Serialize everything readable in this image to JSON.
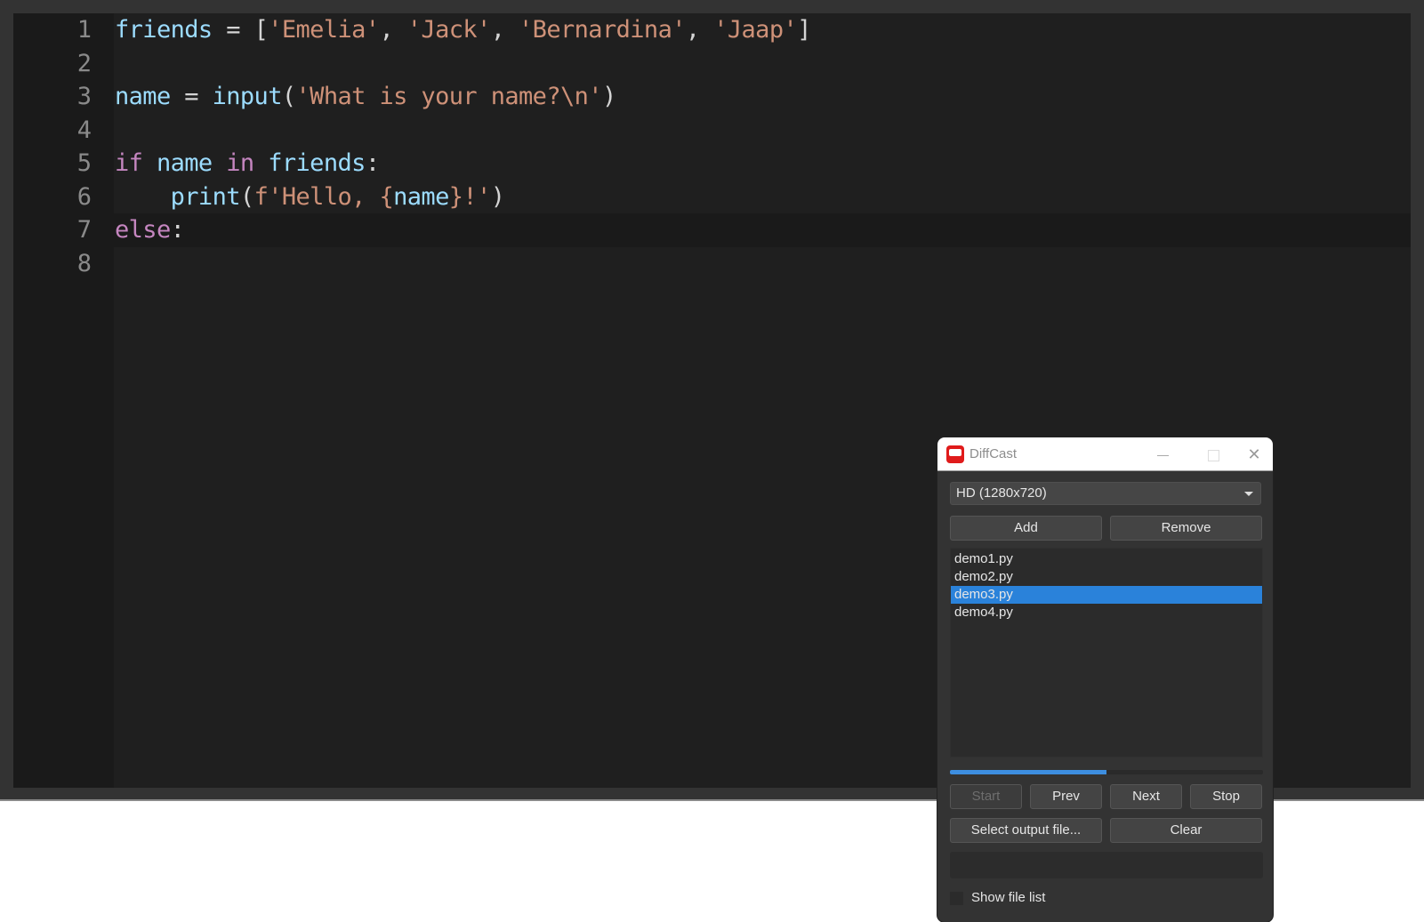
{
  "editor": {
    "current_line": 7,
    "lines": [
      {
        "number": "1",
        "tokens": [
          {
            "t": "friends",
            "c": "var"
          },
          {
            "t": " = ",
            "c": "op"
          },
          {
            "t": "[",
            "c": "op"
          },
          {
            "t": "'Emelia'",
            "c": "str"
          },
          {
            "t": ", ",
            "c": "op"
          },
          {
            "t": "'Jack'",
            "c": "str"
          },
          {
            "t": ", ",
            "c": "op"
          },
          {
            "t": "'Bernardina'",
            "c": "str"
          },
          {
            "t": ", ",
            "c": "op"
          },
          {
            "t": "'Jaap'",
            "c": "str"
          },
          {
            "t": "]",
            "c": "op"
          }
        ]
      },
      {
        "number": "2",
        "tokens": []
      },
      {
        "number": "3",
        "tokens": [
          {
            "t": "name",
            "c": "var"
          },
          {
            "t": " = ",
            "c": "op"
          },
          {
            "t": "input",
            "c": "fn"
          },
          {
            "t": "(",
            "c": "op"
          },
          {
            "t": "'What is your name?\\n'",
            "c": "str"
          },
          {
            "t": ")",
            "c": "op"
          }
        ]
      },
      {
        "number": "4",
        "tokens": []
      },
      {
        "number": "5",
        "tokens": [
          {
            "t": "if",
            "c": "kw"
          },
          {
            "t": " ",
            "c": "op"
          },
          {
            "t": "name",
            "c": "var"
          },
          {
            "t": " ",
            "c": "op"
          },
          {
            "t": "in",
            "c": "kw"
          },
          {
            "t": " ",
            "c": "op"
          },
          {
            "t": "friends",
            "c": "var"
          },
          {
            "t": ":",
            "c": "op"
          }
        ]
      },
      {
        "number": "6",
        "tokens": [
          {
            "t": "    ",
            "c": "op"
          },
          {
            "t": "print",
            "c": "fn"
          },
          {
            "t": "(",
            "c": "op"
          },
          {
            "t": "f'Hello, ",
            "c": "str"
          },
          {
            "t": "{",
            "c": "br"
          },
          {
            "t": "name",
            "c": "var"
          },
          {
            "t": "}",
            "c": "br"
          },
          {
            "t": "!'",
            "c": "str"
          },
          {
            "t": ")",
            "c": "op"
          }
        ]
      },
      {
        "number": "7",
        "tokens": [
          {
            "t": "else",
            "c": "kw"
          },
          {
            "t": ":",
            "c": "op"
          }
        ]
      },
      {
        "number": "8",
        "tokens": []
      }
    ]
  },
  "dialog": {
    "title": "DiffCast",
    "icon": "diffcast-app-icon",
    "window_controls": {
      "minimize": "minimize-icon",
      "maximize": "maximize-icon",
      "close": "close-icon",
      "close_glyph": "✕"
    },
    "resolution_select": {
      "value": "HD (1280x720)"
    },
    "add_label": "Add",
    "remove_label": "Remove",
    "files": [
      "demo1.py",
      "demo2.py",
      "demo3.py",
      "demo4.py"
    ],
    "selected_file_index": 2,
    "progress": 0.5,
    "start_label": "Start",
    "start_enabled": false,
    "prev_label": "Prev",
    "next_label": "Next",
    "stop_label": "Stop",
    "select_output_label": "Select output file...",
    "clear_label": "Clear",
    "output_path": "",
    "show_file_list_label": "Show file list",
    "show_file_list_checked": false,
    "colors": {
      "accent": "#2a82da",
      "progress": "#3d8ee0",
      "icon": "#e01b1b"
    }
  }
}
